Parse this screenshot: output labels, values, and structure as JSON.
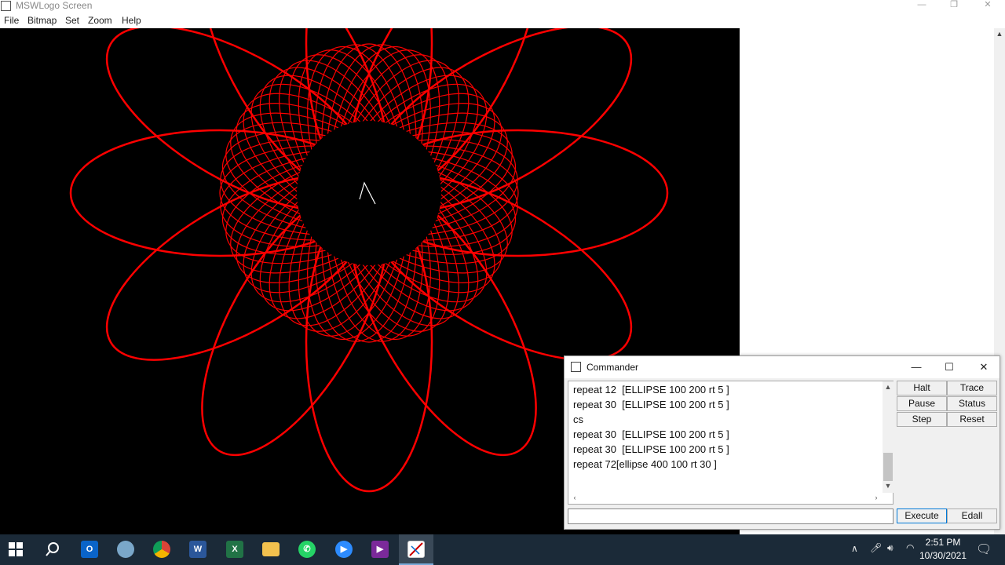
{
  "window": {
    "title": "MSWLogo Screen"
  },
  "menu": [
    "File",
    "Bitmap",
    "Set",
    "Zoom",
    "Help"
  ],
  "colors": {
    "canvas_bg": "#000000",
    "pen": "#ff0000",
    "turtle": "#ffffff",
    "taskbar": "#1b2a38"
  },
  "commander": {
    "title": "Commander",
    "history": [
      "repeat 12  [ELLIPSE 100 200 rt 5 ]",
      "repeat 30  [ELLIPSE 100 200 rt 5 ]",
      "cs",
      "repeat 30  [ELLIPSE 100 200 rt 5 ]",
      "repeat 30  [ELLIPSE 100 200 rt 5 ]",
      "repeat 72[ellipse 400 100 rt 30 ]"
    ],
    "input_value": "",
    "buttons": {
      "halt": "Halt",
      "trace": "Trace",
      "pause": "Pause",
      "status": "Status",
      "step": "Step",
      "reset": "Reset",
      "execute": "Execute",
      "edall": "Edall"
    }
  },
  "taskbar": {
    "icons": [
      "windows-start-icon",
      "search-icon",
      "outlook-icon",
      "paint-icon",
      "chrome-icon",
      "word-icon",
      "excel-icon",
      "file-explorer-icon",
      "whatsapp-icon",
      "zoom-icon",
      "video-editor-icon",
      "mswlogo-icon"
    ],
    "time": "2:51 PM",
    "date": "10/30/2021"
  }
}
